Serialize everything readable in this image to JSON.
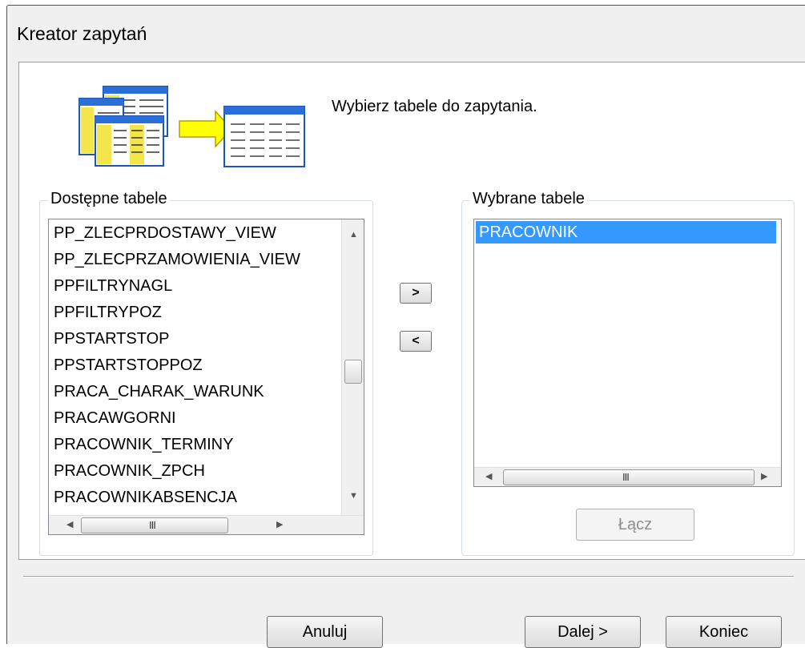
{
  "window": {
    "title": "Kreator zapytań"
  },
  "prompt": "Wybierz tabele do zapytania.",
  "available": {
    "label": "Dostępne tabele",
    "items": [
      "PP_ZLECPRDOSTAWY_VIEW",
      "PP_ZLECPRZAMOWIENIA_VIEW",
      "PPFILTRYNAGL",
      "PPFILTRYPOZ",
      "PPSTARTSTOP",
      "PPSTARTSTOPPOZ",
      "PRACA_CHARAK_WARUNK",
      "PRACAWGORNI",
      "PRACOWNIK_TERMINY",
      "PRACOWNIK_ZPCH",
      "PRACOWNIKABSENCJA"
    ]
  },
  "selected": {
    "label": "Wybrane tabele",
    "items": [
      "PRACOWNIK"
    ],
    "highlight_color": "#3399ff"
  },
  "transfer": {
    "add_label": ">",
    "remove_label": "<"
  },
  "join_button": "Łącz",
  "footer": {
    "cancel": "Anuluj",
    "next": "Dalej >",
    "finish": "Koniec"
  },
  "scrollbar": {
    "grip": "III"
  },
  "icons": {
    "up": "triangle-up",
    "down": "triangle-down",
    "left": "triangle-left",
    "right": "triangle-right",
    "wizard": "tables-to-table"
  }
}
